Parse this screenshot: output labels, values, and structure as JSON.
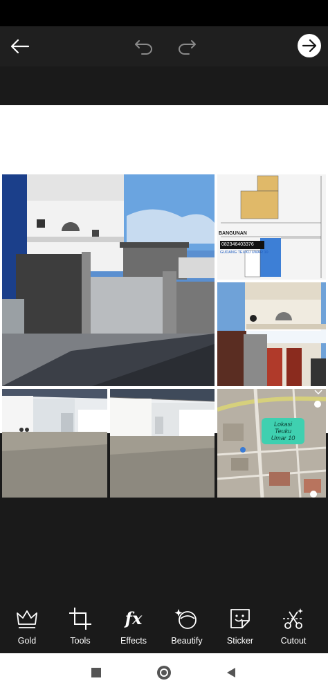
{
  "header": {
    "back_icon": "arrow-left-icon",
    "undo_icon": "undo-icon",
    "redo_icon": "redo-icon",
    "next_icon": "arrow-right-circle-icon"
  },
  "collage": {
    "photos": [
      {
        "name": "building-front-photo"
      },
      {
        "name": "floor-plan-photo",
        "texts": {
          "heading": "BANGUNAN",
          "phone": "082346403376",
          "caption": "GUDANG TEUKU UMAR 10"
        }
      },
      {
        "name": "building-entrance-photo"
      },
      {
        "name": "warehouse-interior-left-photo"
      },
      {
        "name": "warehouse-interior-right-photo"
      },
      {
        "name": "map-screenshot-photo",
        "texts": {
          "label_line1": "Lokasi",
          "label_line2": "Teuku",
          "label_line3": "Umar 10"
        }
      }
    ]
  },
  "toolbar": {
    "items": [
      {
        "label": "Gold",
        "icon": "crown-icon"
      },
      {
        "label": "Tools",
        "icon": "crop-icon"
      },
      {
        "label": "Effects",
        "icon": "fx-icon",
        "glyph": "fx"
      },
      {
        "label": "Beautify",
        "icon": "face-sparkle-icon"
      },
      {
        "label": "Sticker",
        "icon": "sticker-icon"
      },
      {
        "label": "Cutout",
        "icon": "cutout-icon"
      }
    ]
  },
  "navbar": {
    "recents_icon": "square-icon",
    "home_icon": "circle-icon",
    "back_icon": "triangle-back-icon"
  },
  "colors": {
    "background": "#1a1a1a",
    "topbar": "#1f1f1f",
    "map_label": "#3fd0b0"
  }
}
